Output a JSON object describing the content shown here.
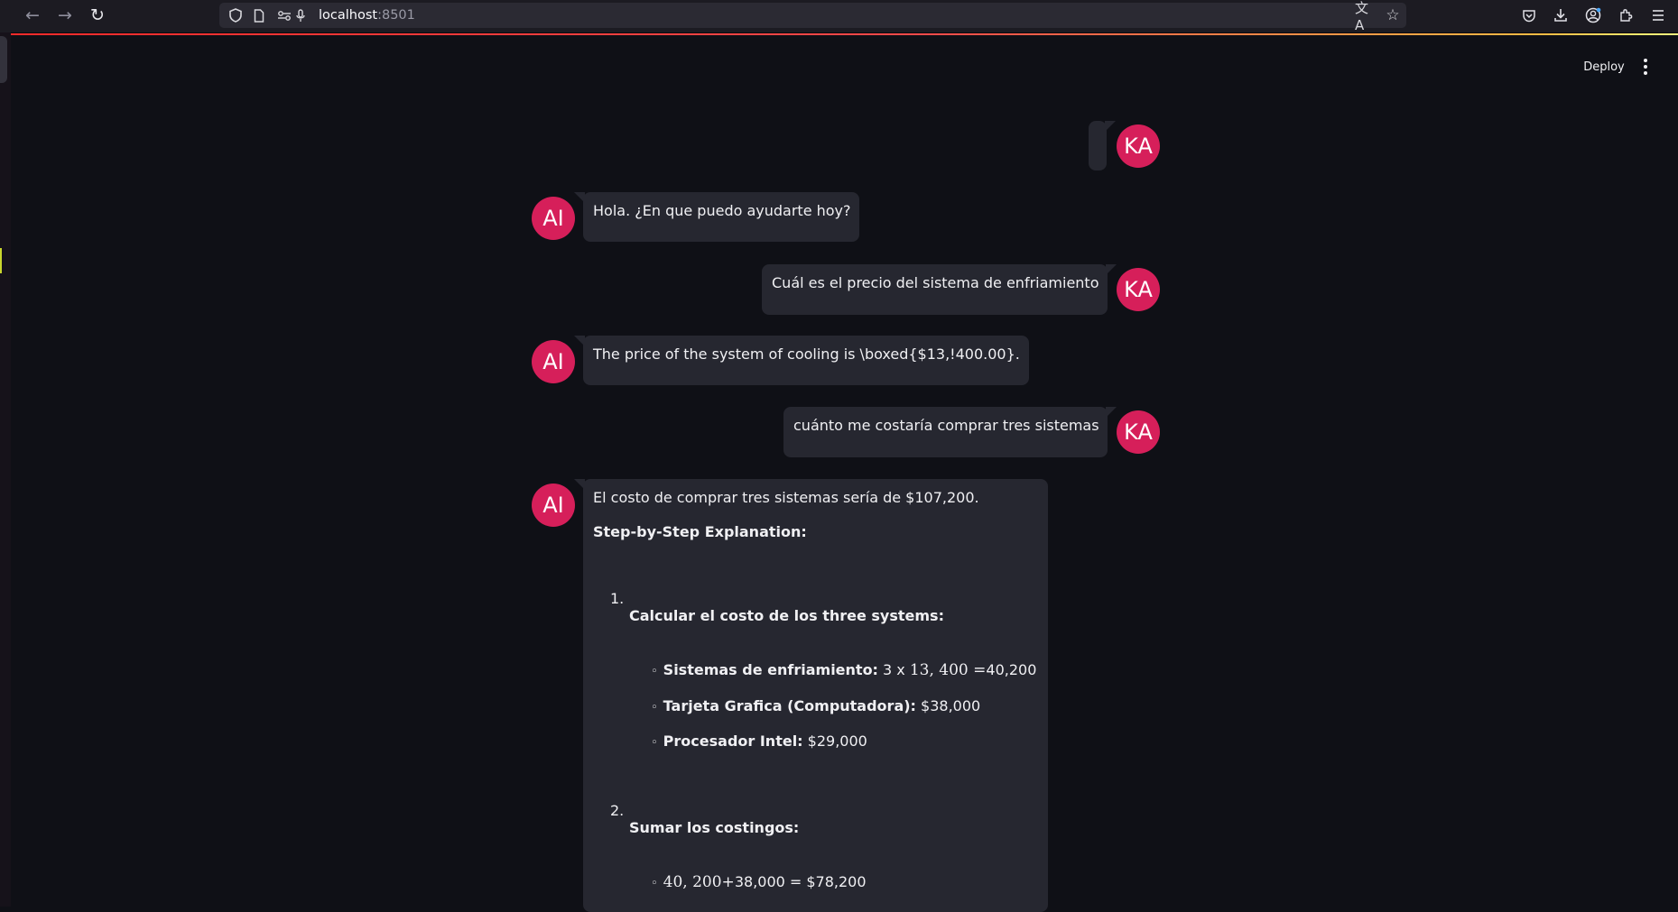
{
  "browser": {
    "url_host": "localhost",
    "url_port": ":8501",
    "icons": [
      "back-arrow-icon",
      "forward-arrow-icon",
      "reload-icon",
      "shield-icon",
      "page-icon",
      "permissions-icon",
      "microphone-icon",
      "translate-icon",
      "bookmark-star-icon",
      "pocket-icon",
      "download-icon",
      "account-icon",
      "extensions-icon",
      "menu-icon"
    ]
  },
  "app": {
    "deploy_label": "Deploy"
  },
  "accent_colors": {
    "avatar": "#d61f5a",
    "bubble": "#262730",
    "background": "#0f1016"
  },
  "messages": [
    {
      "role": "user",
      "avatar": "KA",
      "text": ""
    },
    {
      "role": "assistant",
      "avatar": "AI",
      "text": "Hola. ¿En que puedo ayudarte hoy?"
    },
    {
      "role": "user",
      "avatar": "KA",
      "text": "Cuál es el precio del sistema de enfriamiento"
    },
    {
      "role": "assistant",
      "avatar": "AI",
      "text": "The price of the system of cooling is \\boxed{$13,!400.00}."
    },
    {
      "role": "user",
      "avatar": "KA",
      "text": "cuánto me costaría comprar tres sistemas"
    },
    {
      "role": "assistant",
      "avatar": "AI"
    }
  ],
  "answer": {
    "intro": "El costo de comprar tres sistemas sería de $107,200.",
    "heading": "Step-by-Step Explanation:",
    "steps": [
      {
        "num": "1.",
        "title": "Calcular el costo de los three systems:",
        "items": [
          {
            "label": "Sistemas de enfriamiento:",
            "pre": " 3 x ",
            "math": "13, 400 =",
            "post": "40,200"
          },
          {
            "label": "Tarjeta Grafica (Computadora):",
            "post": " $38,000"
          },
          {
            "label": "Procesador Intel:",
            "post": " $29,000"
          }
        ]
      },
      {
        "num": "2.",
        "title": "Sumar los costingos:",
        "items": [
          {
            "math": "40, 200+",
            "post": "38,000 = $78,200"
          }
        ]
      }
    ]
  }
}
